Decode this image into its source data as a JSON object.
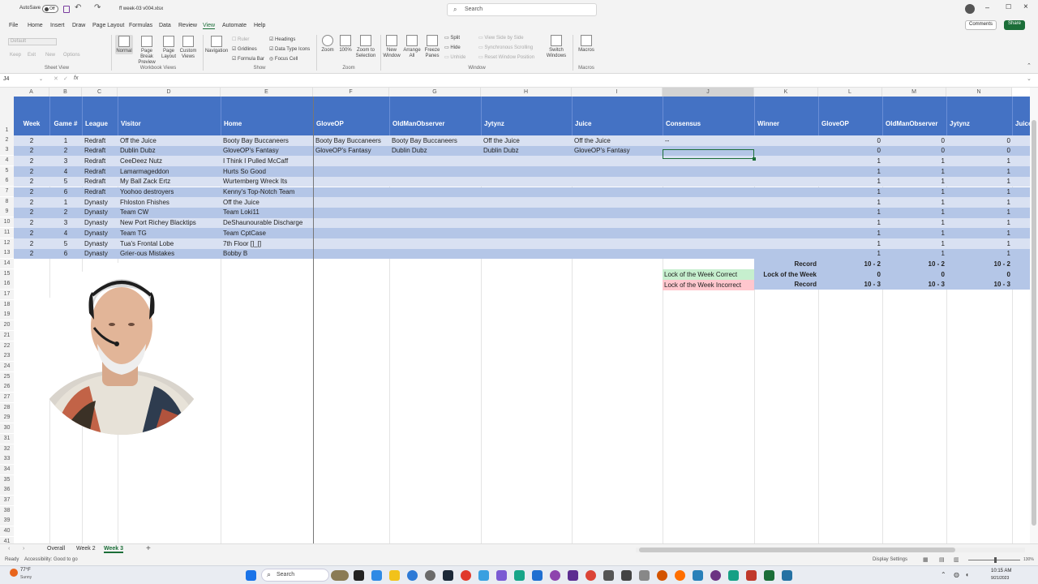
{
  "app": {
    "autosave_label": "AutoSave",
    "autosave_state": "Off",
    "file_name": "ff week-03 v004.xlsx",
    "search_placeholder": "Search",
    "comments_label": "Comments",
    "share_label": "Share"
  },
  "menu": [
    "File",
    "Home",
    "Insert",
    "Draw",
    "Page Layout",
    "Formulas",
    "Data",
    "Review",
    "View",
    "Automate",
    "Help"
  ],
  "menu_active": "View",
  "ribbon": {
    "sheet_view": {
      "label": "Sheet View",
      "items": [
        "Default",
        "Keep",
        "Exit",
        "New",
        "Options"
      ]
    },
    "workbook_views": {
      "label": "Workbook Views",
      "items": [
        "Normal",
        "Page Break Preview",
        "Page Layout",
        "Custom Views"
      ]
    },
    "show": {
      "label": "Show",
      "items": [
        "Navigation",
        "Ruler",
        "Gridlines",
        "Formula Bar",
        "Headings",
        "Data Type Icons",
        "Focus Cell"
      ]
    },
    "zoom": {
      "label": "Zoom",
      "items": [
        "Zoom",
        "100%",
        "Zoom to Selection"
      ]
    },
    "window": {
      "label": "Window",
      "items": [
        "New Window",
        "Arrange All",
        "Freeze Panes",
        "Split",
        "Hide",
        "Unhide",
        "View Side by Side",
        "Synchronous Scrolling",
        "Reset Window Position",
        "Switch Windows"
      ]
    },
    "macros": {
      "label": "Macros",
      "items": [
        "Macros"
      ]
    }
  },
  "formula_bar": {
    "name_box": "J4",
    "fx": "fx",
    "value": ""
  },
  "columns": [
    "A",
    "B",
    "C",
    "D",
    "E",
    "F",
    "G",
    "H",
    "I",
    "J",
    "K",
    "L",
    "M",
    "N"
  ],
  "headers": [
    "Week",
    "Game #",
    "League",
    "Visitor",
    "Home",
    "GloveOP",
    "OldManObserver",
    "Jytynz",
    "Juice",
    "Consensus",
    "Winner",
    "GloveOP",
    "OldManObserver",
    "Jytynz",
    "Juice"
  ],
  "rows": [
    {
      "week": "2",
      "game": "1",
      "league": "Redraft",
      "visitor": "Off the Juice",
      "home": "Booty Bay Buccaneers",
      "f": "Booty Bay Buccaneers",
      "g": "Booty Bay Buccaneers",
      "h": "Off the Juice",
      "i": "Off the Juice",
      "j": "--",
      "l": "0",
      "m": "0",
      "n": "0"
    },
    {
      "week": "2",
      "game": "2",
      "league": "Redraft",
      "visitor": "Dublin Dubz",
      "home": "GloveOP's Fantasy",
      "f": "GloveOP's Fantasy",
      "g": "Dublin Dubz",
      "h": "Dublin Dubz",
      "i": "GloveOP's Fantasy",
      "j": "",
      "l": "0",
      "m": "0",
      "n": "0"
    },
    {
      "week": "2",
      "game": "3",
      "league": "Redraft",
      "visitor": "CeeDeez Nutz",
      "home": "I Think I Pulled McCaff",
      "f": "",
      "g": "",
      "h": "",
      "i": "",
      "j": "",
      "l": "1",
      "m": "1",
      "n": "1"
    },
    {
      "week": "2",
      "game": "4",
      "league": "Redraft",
      "visitor": "Lamarmageddon",
      "home": "Hurts So Good",
      "f": "",
      "g": "",
      "h": "",
      "i": "",
      "j": "",
      "l": "1",
      "m": "1",
      "n": "1"
    },
    {
      "week": "2",
      "game": "5",
      "league": "Redraft",
      "visitor": "My Ball Zack Ertz",
      "home": "Wurtemberg Wreck Its",
      "f": "",
      "g": "",
      "h": "",
      "i": "",
      "j": "",
      "l": "1",
      "m": "1",
      "n": "1"
    },
    {
      "week": "2",
      "game": "6",
      "league": "Redraft",
      "visitor": "Yoohoo destroyers",
      "home": "Kenny's Top-Notch Team",
      "f": "",
      "g": "",
      "h": "",
      "i": "",
      "j": "",
      "l": "1",
      "m": "1",
      "n": "1"
    },
    {
      "week": "2",
      "game": "1",
      "league": "Dynasty",
      "visitor": "Fhloston Fhishes",
      "home": "Off the Juice",
      "f": "",
      "g": "",
      "h": "",
      "i": "",
      "j": "",
      "l": "1",
      "m": "1",
      "n": "1"
    },
    {
      "week": "2",
      "game": "2",
      "league": "Dynasty",
      "visitor": "Team CW",
      "home": "Team Loki11",
      "f": "",
      "g": "",
      "h": "",
      "i": "",
      "j": "",
      "l": "1",
      "m": "1",
      "n": "1"
    },
    {
      "week": "2",
      "game": "3",
      "league": "Dynasty",
      "visitor": "New Port Richey Blacktips",
      "home": "DeShaunourable Discharge",
      "f": "",
      "g": "",
      "h": "",
      "i": "",
      "j": "",
      "l": "1",
      "m": "1",
      "n": "1"
    },
    {
      "week": "2",
      "game": "4",
      "league": "Dynasty",
      "visitor": "Team TG",
      "home": "Team CptCase",
      "f": "",
      "g": "",
      "h": "",
      "i": "",
      "j": "",
      "l": "1",
      "m": "1",
      "n": "1"
    },
    {
      "week": "2",
      "game": "5",
      "league": "Dynasty",
      "visitor": "Tua's Frontal Lobe",
      "home": "7th Floor []_[]",
      "f": "",
      "g": "",
      "h": "",
      "i": "",
      "j": "",
      "l": "1",
      "m": "1",
      "n": "1"
    },
    {
      "week": "2",
      "game": "6",
      "league": "Dynasty",
      "visitor": "Grier-ous Mistakes",
      "home": "Bobby B",
      "f": "",
      "g": "",
      "h": "",
      "i": "",
      "j": "",
      "l": "1",
      "m": "1",
      "n": "1"
    }
  ],
  "summary": {
    "record_label": "Record",
    "lock_label": "Lock of the Week",
    "lock_correct": "Lock of the Week Correct",
    "lock_incorrect": "Lock of the Week Incorrect",
    "rec1": [
      "10 - 2",
      "10 - 2",
      "10 - 2"
    ],
    "lock": [
      "0",
      "0",
      "0"
    ],
    "rec2": [
      "10 - 3",
      "10 - 3",
      "10 - 3"
    ],
    "correct_color": "#c6efce",
    "incorrect_color": "#ffc7ce"
  },
  "row_numbers": [
    "1",
    "2",
    "3",
    "4",
    "5",
    "6",
    "7",
    "8",
    "9",
    "10",
    "11",
    "12",
    "13",
    "14",
    "15",
    "16",
    "17",
    "18",
    "19",
    "20",
    "21",
    "22",
    "23",
    "24",
    "25",
    "26",
    "27",
    "28",
    "29",
    "30",
    "31",
    "32",
    "33",
    "34",
    "35",
    "36",
    "37",
    "38",
    "39",
    "40",
    "41"
  ],
  "sheets": [
    "Overall",
    "Week 2",
    "Week 3"
  ],
  "active_sheet": "Week 3",
  "status": {
    "ready": "Ready",
    "accessibility": "Accessibility: Good to go",
    "display_settings": "Display Settings",
    "zoom": "130%"
  },
  "taskbar": {
    "weather_temp": "77°F",
    "weather_desc": "Sunny",
    "search": "Search",
    "time": "10:15 AM",
    "date": "9/21/2023"
  },
  "colors": {
    "header_blue": "#4472c4",
    "band_light": "#d9e1f2",
    "band_mid": "#b4c6e7",
    "excel_green": "#1b6e38"
  }
}
